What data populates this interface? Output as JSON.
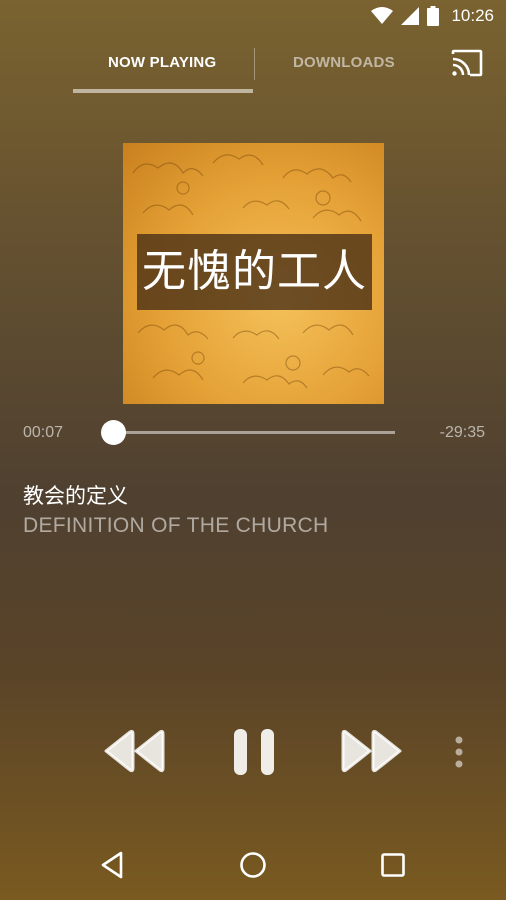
{
  "status_bar": {
    "time": "10:26"
  },
  "tabs": [
    {
      "label": "NOW PLAYING",
      "active": true
    },
    {
      "label": "DOWNLOADS",
      "active": false
    }
  ],
  "cover": {
    "title": "无愧的工人"
  },
  "player": {
    "elapsed": "00:07",
    "remaining": "-29:35",
    "progress_fraction": 0.005
  },
  "track": {
    "title": "教会的定义",
    "subtitle": "DEFINITION OF THE CHURCH"
  },
  "colors": {
    "accent": "#ffffff",
    "cover_gold": "#e4a035"
  },
  "icons": [
    "wifi-icon",
    "signal-icon",
    "battery-icon",
    "cast-icon",
    "rewind-icon",
    "pause-icon",
    "fast-forward-icon",
    "more-vert-icon",
    "back-icon",
    "home-icon",
    "recents-icon"
  ]
}
